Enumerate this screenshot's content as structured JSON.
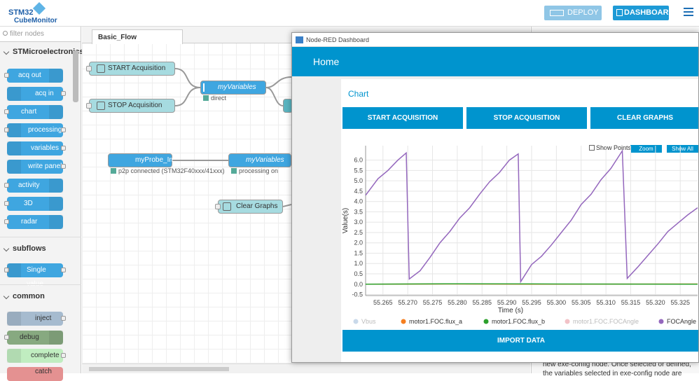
{
  "header": {
    "logo_line1": "STM32",
    "logo_line2": "CubeMonitor",
    "deploy_label": "DEPLOY",
    "dashboard_label": "DASHBOARD"
  },
  "palette": {
    "filter_placeholder": "filter nodes",
    "categories": [
      "STMicroelectronics",
      "subflows",
      "common"
    ],
    "st_nodes": [
      "acq out",
      "acq in",
      "chart",
      "processing",
      "variables",
      "write panel",
      "activity",
      "3D",
      "radar"
    ],
    "subflow_nodes": [
      "Single value"
    ],
    "common_nodes": [
      "inject",
      "debug",
      "complete",
      "catch"
    ]
  },
  "workspace": {
    "tab": "Basic_Flow",
    "nodes": {
      "start": "START Acquisition",
      "stop": "STOP Acquisition",
      "myvars1": "myVariables",
      "myvars1_status": "direct",
      "probe": "myProbe_In",
      "probe_status": "p2p connected (STM32F40xxx/41xxx)",
      "myvars2": "myVariables",
      "myvars2_status": "processing on",
      "clear": "Clear Graphs"
    }
  },
  "sidebar": {
    "info_text": "new exe-config node. Once selected or defined, the variables selected in exe-config node are"
  },
  "dashboard": {
    "window_title": "Node-RED Dashboard",
    "header": "Home",
    "card_title": "Chart",
    "buttons": [
      "START ACQUISITION",
      "STOP ACQUISITION",
      "CLEAR GRAPHS"
    ],
    "show_points": "Show Points",
    "zoom": "Zoom",
    "show_all": "Show All",
    "import": "IMPORT DATA"
  },
  "chart_data": {
    "type": "line",
    "xlabel": "Time (s)",
    "ylabel": "Value(s)",
    "xlim": [
      55.2615,
      55.3285
    ],
    "ylim": [
      -0.55,
      6.7
    ],
    "xticks": [
      "55.265",
      "55.270",
      "55.275",
      "55.280",
      "55.285",
      "55.290",
      "55.295",
      "55.300",
      "55.305",
      "55.310",
      "55.315",
      "55.320",
      "55.325"
    ],
    "yticks": [
      "6.0",
      "5.5",
      "5.0",
      "4.5",
      "4.0",
      "3.5",
      "3.0",
      "2.5",
      "2.0",
      "1.5",
      "1.0",
      "0.5",
      "0.0",
      "-0.5"
    ],
    "series": [
      {
        "name": "Vbus",
        "color": "#c9d9ea",
        "x": [],
        "y": []
      },
      {
        "name": "motor1.FOC.flux_a",
        "color": "#f57f20",
        "x": [
          55.2615,
          55.28,
          55.3,
          55.3285
        ],
        "y": [
          0.0,
          0.01,
          0.0,
          0.01
        ]
      },
      {
        "name": "motor1.FOC.flux_b",
        "color": "#2ca02c",
        "x": [
          55.2615,
          55.28,
          55.3,
          55.3285
        ],
        "y": [
          0.0,
          0.02,
          0.01,
          0.0
        ]
      },
      {
        "name": "motor1.FOC.FOCAngle",
        "color": "#f2c2c7",
        "x": [],
        "y": []
      },
      {
        "name": "FOCAngle",
        "color": "#9467bd",
        "x": [
          55.2615,
          55.264,
          55.266,
          55.268,
          55.2697,
          55.2703,
          55.2725,
          55.2745,
          55.2765,
          55.2785,
          55.2805,
          55.2825,
          55.2845,
          55.2865,
          55.2885,
          55.2905,
          55.2923,
          55.2928,
          55.295,
          55.297,
          55.299,
          55.301,
          55.303,
          55.305,
          55.307,
          55.309,
          55.311,
          55.3133,
          55.3143,
          55.3165,
          55.3185,
          55.3205,
          55.3225,
          55.3245,
          55.3265,
          55.3285
        ],
        "y": [
          4.3,
          5.1,
          5.5,
          6.0,
          6.35,
          0.25,
          0.65,
          1.3,
          2.0,
          2.55,
          3.2,
          3.7,
          4.35,
          4.95,
          5.4,
          6.0,
          6.3,
          0.12,
          0.95,
          1.35,
          1.9,
          2.5,
          3.1,
          3.85,
          4.35,
          5.05,
          5.6,
          6.45,
          0.28,
          0.85,
          1.4,
          1.95,
          2.55,
          2.95,
          3.35,
          3.7
        ]
      }
    ]
  }
}
